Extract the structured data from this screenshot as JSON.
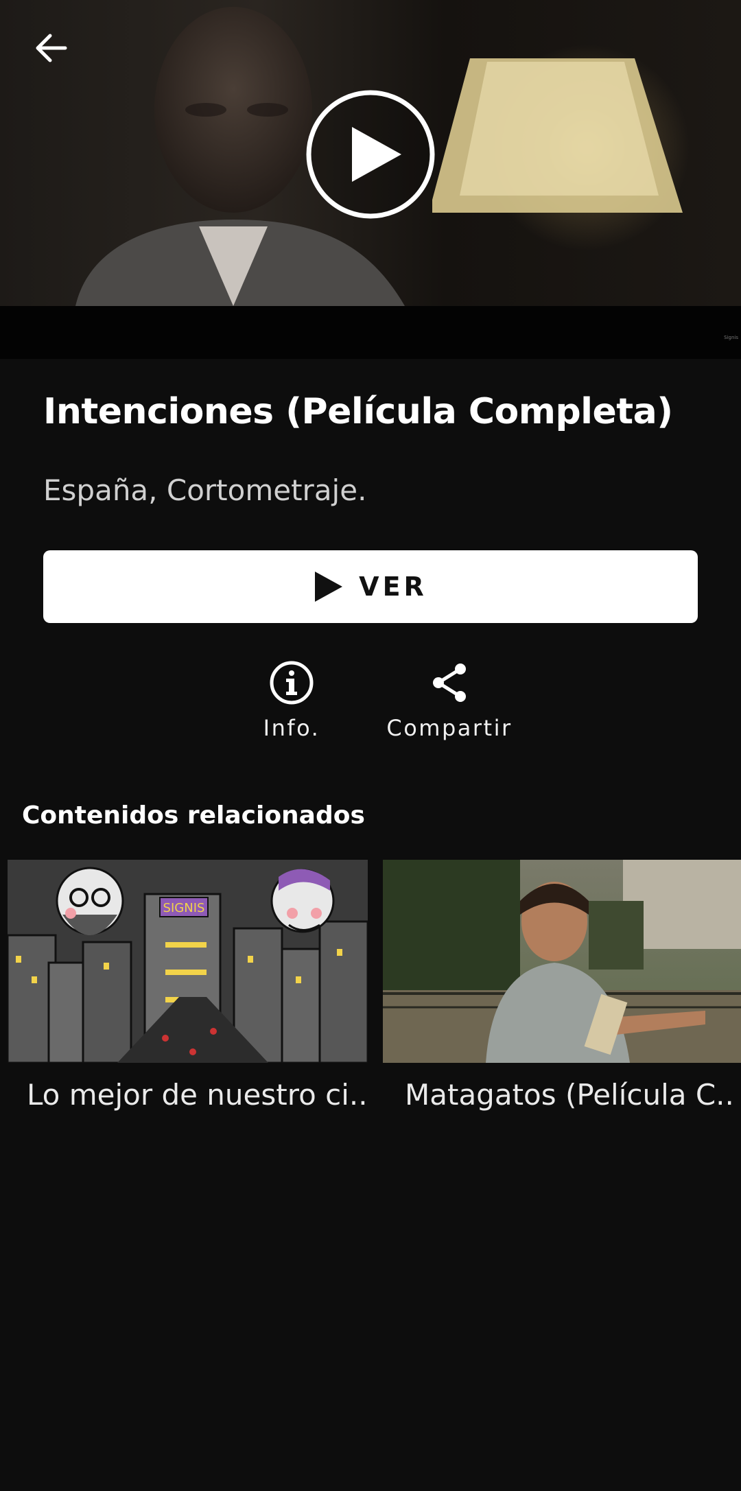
{
  "video": {
    "watermark": "Signis"
  },
  "header": {
    "back_icon": "arrow-left-icon",
    "play_icon": "play-circle-icon"
  },
  "content": {
    "title": "Intenciones (Película Completa)",
    "subtitle": "España, Cortometraje.",
    "watch_button_label": "VER",
    "actions": [
      {
        "label": "Info.",
        "icon": "info-icon"
      },
      {
        "label": "Compartir",
        "icon": "share-icon"
      }
    ]
  },
  "related": {
    "heading": "Contenidos relacionados",
    "items": [
      {
        "title": "Lo mejor de nuestro ci..",
        "thumbnail": "illustrated-city-caricature",
        "sign_text": "SIGNIS"
      },
      {
        "title": "Matagatos (Película C..",
        "thumbnail": "boy-outdoors-still"
      }
    ]
  },
  "colors": {
    "background": "#0d0d0d",
    "primary_button": "#ffffff",
    "text": "#ffffff"
  }
}
